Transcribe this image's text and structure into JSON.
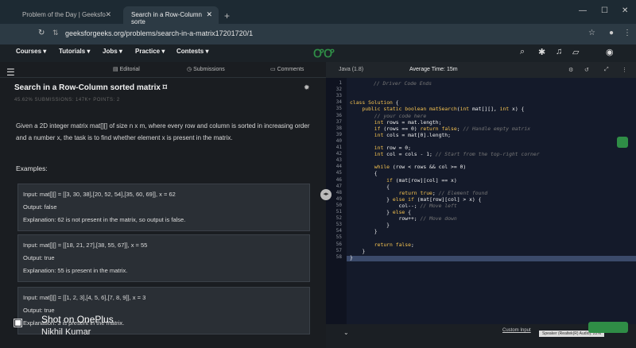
{
  "browser": {
    "tabs": [
      {
        "label": "Problem of the Day | Geeksfo"
      },
      {
        "label": "Search in a Row-Column sorte"
      }
    ],
    "url": "geeksforgeeks.org/problems/search-in-a-matrix17201720/1"
  },
  "nav": {
    "items": [
      "Courses",
      "Tutorials",
      "Jobs",
      "Practice",
      "Contests"
    ]
  },
  "subtabs": [
    "Editorial",
    "Submissions",
    "Comments"
  ],
  "problem": {
    "title": "Search in a Row-Column sorted matrix",
    "meta": "45.62%   SUBMISSIONS: 147K+   POINTS: 2",
    "description": "Given a 2D integer matrix mat[][] of size n x m, where every row and column is sorted in increasing order and a number x, the task is to find whether element x is present in the matrix.",
    "examples_label": "Examples:",
    "examples": [
      {
        "input": "Input:  mat[][] = [[3, 30, 38],[20, 52, 54],[35, 60, 69]], x = 62",
        "output": "Output:  false",
        "explanation": "Explanation:  62 is not present in the matrix, so output is false."
      },
      {
        "input": "Input:  mat[][] = [[18, 21, 27],[38, 55, 67]], x = 55",
        "output": "Output:  true",
        "explanation": "Explanation:  55 is present in the matrix."
      },
      {
        "input": "Input:  mat[][] = [[1, 2, 3],[4, 5, 6],[7, 8, 9]], x = 3",
        "output": "Output:  true",
        "explanation": "Explanation:  3 is present in the matrix."
      }
    ]
  },
  "editor": {
    "language": "Java (1.8)",
    "avg_time": "Average Time: 15m",
    "header_comment": "// Driver Code Ends",
    "line_numbers": [
      "1",
      "32",
      "33",
      "34",
      "35",
      "36",
      "37",
      "38",
      "39",
      "40",
      "41",
      "42",
      "43",
      "44",
      "45",
      "46",
      "47",
      "48",
      "49",
      "50",
      "51",
      "52",
      "53",
      "54",
      "55",
      "56",
      "57",
      "58"
    ],
    "code_lines": [
      "",
      "",
      "",
      "class Solution {",
      "    public static boolean matSearch(int mat[][], int x) {",
      "        // your code here",
      "        int rows = mat.length;",
      "        if (rows == 0) return false; // Handle empty matrix",
      "        int cols = mat[0].length;",
      "",
      "        int row = 0;",
      "        int col = cols - 1; // Start from the top-right corner",
      "",
      "        while (row < rows && col >= 0)",
      "        {",
      "            if (mat[row][col] == x)",
      "            {",
      "                return true; // Element found",
      "            } else if (mat[row][col] > x) {",
      "                col--; // Move left",
      "            } else {",
      "                row++; // Move down",
      "            }",
      "        }",
      "",
      "        return false;",
      "    }",
      "}"
    ],
    "custom_input": "Custom Input",
    "tooltip": "Speaker (Realtek(R) Audio): 22%"
  },
  "watermark": {
    "line1": "Shot on OnePlus",
    "line2": "Nikhil Kumar"
  }
}
